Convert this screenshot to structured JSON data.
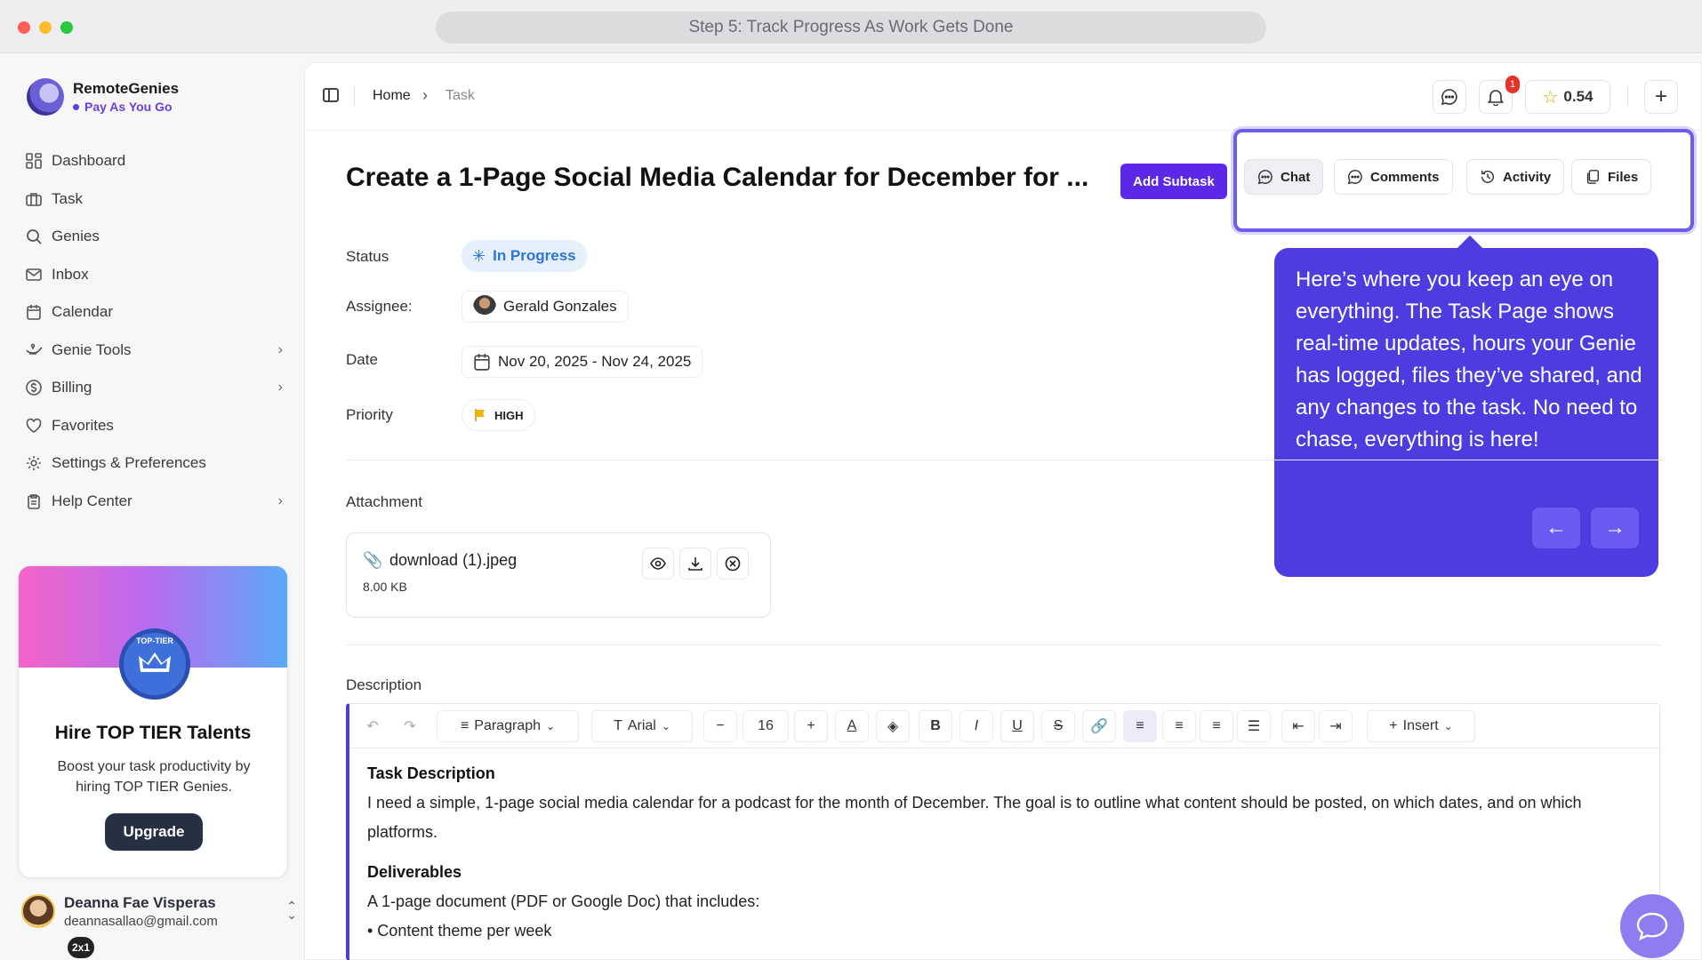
{
  "window": {
    "title": "Step 5: Track Progress As Work Gets Done"
  },
  "brand": {
    "name": "RemoteGenies",
    "plan": "Pay As You Go"
  },
  "sidebar": {
    "items": [
      {
        "label": "Dashboard",
        "icon": "dashboard-icon",
        "has_chevron": false
      },
      {
        "label": "Task",
        "icon": "briefcase-icon",
        "has_chevron": false
      },
      {
        "label": "Genies",
        "icon": "search-icon",
        "has_chevron": false
      },
      {
        "label": "Inbox",
        "icon": "mail-icon",
        "has_chevron": false
      },
      {
        "label": "Calendar",
        "icon": "calendar-icon",
        "has_chevron": false
      },
      {
        "label": "Genie Tools",
        "icon": "genie-lamp-icon",
        "has_chevron": true
      },
      {
        "label": "Billing",
        "icon": "dollar-circle-icon",
        "has_chevron": true
      },
      {
        "label": "Favorites",
        "icon": "heart-icon",
        "has_chevron": false
      },
      {
        "label": "Settings & Preferences",
        "icon": "gear-icon",
        "has_chevron": false
      },
      {
        "label": "Help Center",
        "icon": "clipboard-icon",
        "has_chevron": true
      }
    ]
  },
  "promo": {
    "badge_text": "TOP-TIER",
    "title": "Hire TOP TIER Talents",
    "description": "Boost your task productivity by hiring TOP TIER Genies.",
    "button": "Upgrade"
  },
  "user": {
    "name": "Deanna Fae Visperas",
    "email": "deannasallao@gmail.com"
  },
  "zoom_badge": "2x1",
  "breadcrumb": {
    "home": "Home",
    "current": "Task"
  },
  "topbar": {
    "notification_count": "1",
    "credits": "0.54"
  },
  "task": {
    "title": "Create a 1-Page Social Media Calendar for December for ...",
    "add_subtask": "Add Subtask",
    "status_label": "Status",
    "status_value": "In Progress",
    "assignee_label": "Assignee:",
    "assignee_value": "Gerald Gonzales",
    "date_label": "Date",
    "date_value": "Nov 20, 2025 - Nov 24, 2025",
    "priority_label": "Priority",
    "priority_value": "HIGH"
  },
  "tabs": [
    {
      "label": "Chat",
      "icon": "chat-bubble-icon"
    },
    {
      "label": "Comments",
      "icon": "comment-icon"
    },
    {
      "label": "Activity",
      "icon": "history-icon"
    },
    {
      "label": "Files",
      "icon": "files-icon"
    }
  ],
  "tooltip": {
    "text": "Here’s where you keep an eye on everything. The Task Page shows real-time updates, hours your Genie has logged, files they’ve shared, and any changes to the task. No need to chase, everything is here!"
  },
  "attachment": {
    "section_label": "Attachment",
    "file_name": "download (1).jpeg",
    "file_size": "8.00 KB"
  },
  "description": {
    "section_label": "Description",
    "toolbar": {
      "block_format": "Paragraph",
      "font": "Arial",
      "font_size": "16",
      "insert": "Insert"
    },
    "heading1": "Task Description",
    "para1": "I need a simple, 1-page social media calendar for a podcast for the month of December. The goal is to outline what content should be posted, on which dates, and on which platforms.",
    "heading2": "Deliverables",
    "para2": "A 1-page document (PDF or Google Doc) that includes:",
    "bullet1": "• Content theme per week"
  },
  "colors": {
    "accent": "#5a28e6",
    "tooltip_bg": "#4d3ce0",
    "status_blue": "#2b76d8",
    "priority_flag": "#f5b400"
  }
}
